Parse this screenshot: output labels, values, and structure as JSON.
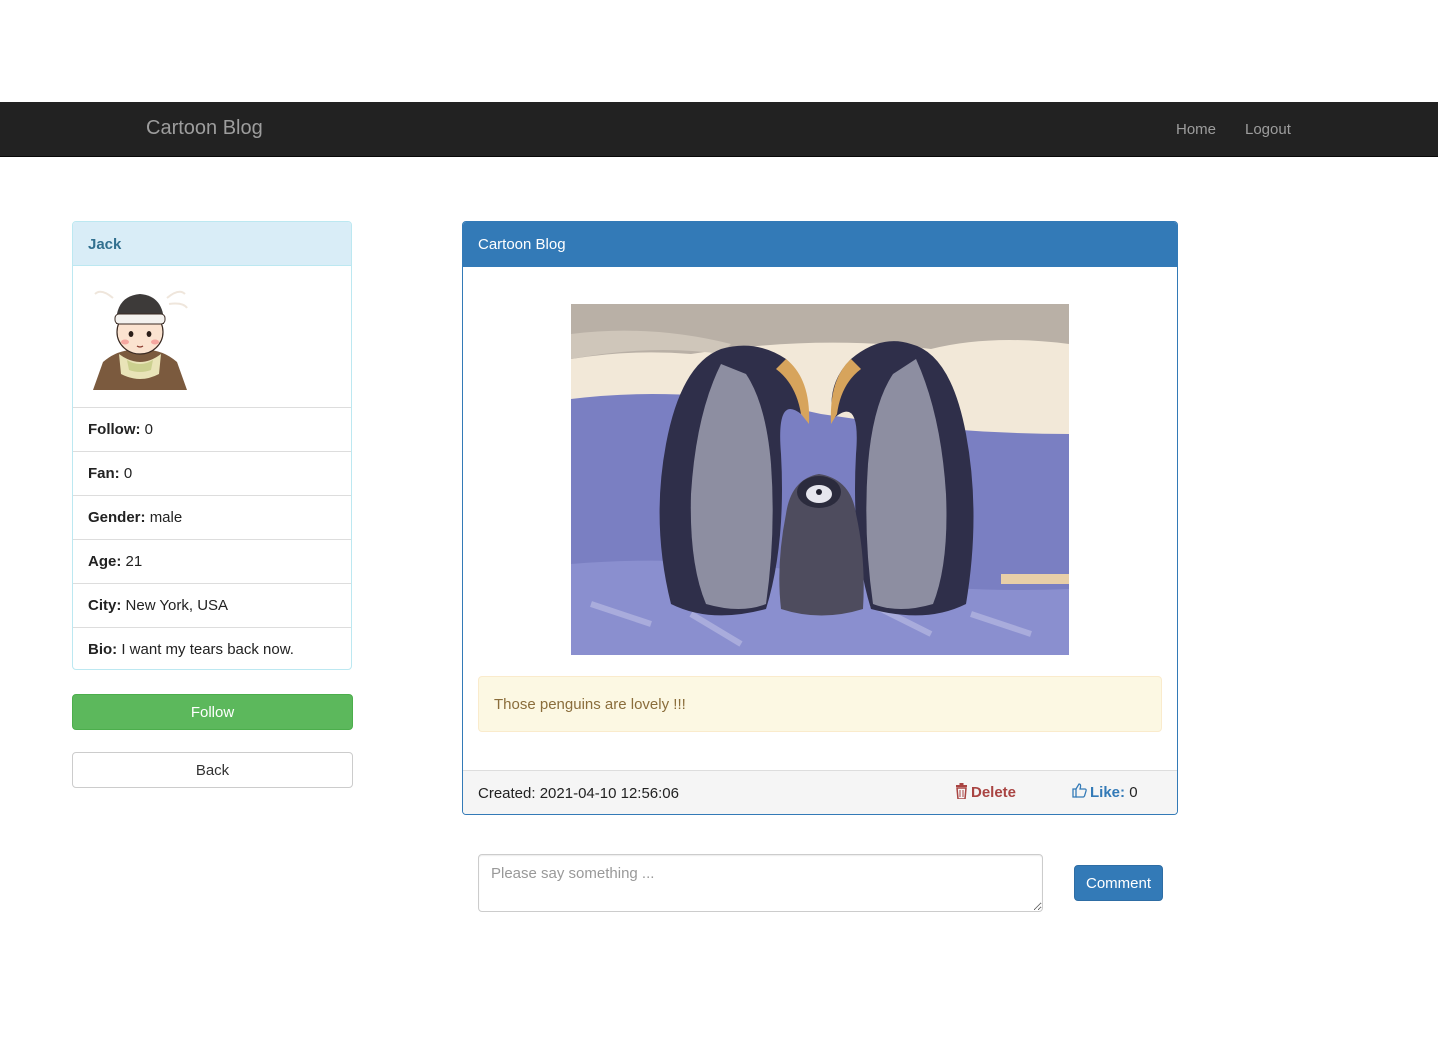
{
  "navbar": {
    "brand": "Cartoon Blog",
    "links": [
      "Home",
      "Logout"
    ]
  },
  "profile": {
    "name": "Jack",
    "fields": [
      {
        "label": "Follow:",
        "value": "0"
      },
      {
        "label": "Fan:",
        "value": "0"
      },
      {
        "label": "Gender:",
        "value": "male"
      },
      {
        "label": "Age:",
        "value": "21"
      },
      {
        "label": "City:",
        "value": "New York, USA"
      },
      {
        "label": "Bio:",
        "value": "I want my tears back now."
      }
    ],
    "follow_label": "Follow",
    "back_label": "Back"
  },
  "post": {
    "title": "Cartoon Blog",
    "image_icon": "penguins-image",
    "text": "Those penguins are lovely !!!",
    "created": "Created: 2021-04-10 12:56:06",
    "delete_label": "Delete",
    "like_label": "Like:",
    "like_count": "0"
  },
  "comment": {
    "placeholder": "Please say something ...",
    "button_label": "Comment"
  },
  "colors": {
    "navbar": "#222222",
    "primary": "#337ab7",
    "success": "#5cb85c",
    "danger": "#a94442",
    "info_bg": "#d9edf7",
    "warning_bg": "#fcf8e3"
  }
}
